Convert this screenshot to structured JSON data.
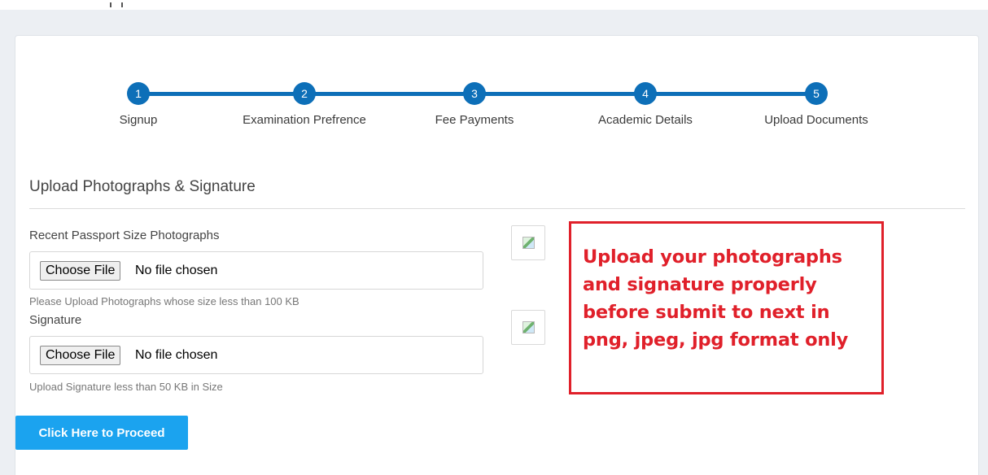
{
  "stepper": {
    "steps": [
      {
        "number": "1",
        "label": "Signup"
      },
      {
        "number": "2",
        "label": "Examination Prefrence"
      },
      {
        "number": "3",
        "label": "Fee Payments"
      },
      {
        "number": "4",
        "label": "Academic Details"
      },
      {
        "number": "5",
        "label": "Upload Documents"
      }
    ],
    "accent_color": "#0d6fb8"
  },
  "section": {
    "title": "Upload Photographs & Signature"
  },
  "photo_field": {
    "label": "Recent Passport Size Photographs",
    "button_label": "Choose File",
    "status": "No file chosen",
    "help": "Please Upload Photographs whose size less than 100 KB",
    "preview_icon": "broken-image-icon"
  },
  "signature_field": {
    "label": "Signature",
    "button_label": "Choose File",
    "status": "No file chosen",
    "help": "Upload Signature less than 50 KB in Size",
    "preview_icon": "broken-image-icon"
  },
  "notice": {
    "lines": [
      "Upload your photographs",
      "and signature properly",
      "before submit to next in",
      "png, jpeg, jpg format only"
    ],
    "color": "#e0202a"
  },
  "actions": {
    "proceed_label": "Click Here to Proceed",
    "proceed_color": "#1ba3ef"
  }
}
